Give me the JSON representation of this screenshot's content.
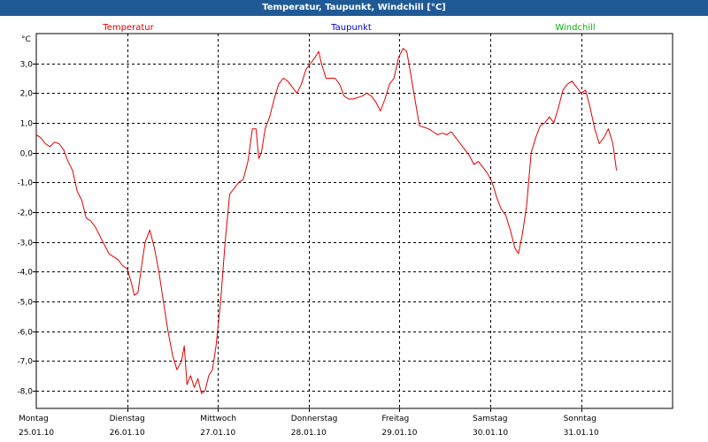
{
  "window": {
    "title": "Temperatur, Taupunkt, Windchill [°C]"
  },
  "legend": [
    {
      "name": "Temperatur",
      "color": "#e00000"
    },
    {
      "name": "Taupunkt",
      "color": "#0000d0"
    },
    {
      "name": "Windchill",
      "color": "#10b010"
    }
  ],
  "chart_data": {
    "type": "line",
    "title": "Temperatur, Taupunkt, Windchill [°C]",
    "ylabel": "°C",
    "xlabel": "",
    "ylim": [
      -8.6,
      4.0
    ],
    "xlim": [
      0,
      7
    ],
    "grid": true,
    "legend_position": "top",
    "y_ticks": [
      "3,0",
      "2,0",
      "1,0",
      "0,0",
      "-1,0",
      "-2,0",
      "-3,0",
      "-4,0",
      "-5,0",
      "-6,0",
      "-7,0",
      "-8,0"
    ],
    "y_tick_values": [
      3,
      2,
      1,
      0,
      -1,
      -2,
      -3,
      -4,
      -5,
      -6,
      -7,
      -8
    ],
    "x_categories": [
      {
        "day": "Montag",
        "date": "25.01.10"
      },
      {
        "day": "Dienstag",
        "date": "26.01.10"
      },
      {
        "day": "Mittwoch",
        "date": "27.01.10"
      },
      {
        "day": "Donnerstag",
        "date": "28.01.10"
      },
      {
        "day": "Freitag",
        "date": "29.01.10"
      },
      {
        "day": "Samstag",
        "date": "30.01.10"
      },
      {
        "day": "Sonntag",
        "date": "31.01.10"
      }
    ],
    "series": [
      {
        "name": "Temperatur",
        "color": "#e00000",
        "points": [
          [
            0.0,
            0.6
          ],
          [
            0.05,
            0.5
          ],
          [
            0.1,
            0.3
          ],
          [
            0.15,
            0.2
          ],
          [
            0.2,
            0.35
          ],
          [
            0.25,
            0.3
          ],
          [
            0.3,
            0.1
          ],
          [
            0.35,
            -0.3
          ],
          [
            0.4,
            -0.6
          ],
          [
            0.45,
            -1.3
          ],
          [
            0.5,
            -1.6
          ],
          [
            0.55,
            -2.2
          ],
          [
            0.6,
            -2.3
          ],
          [
            0.65,
            -2.5
          ],
          [
            0.7,
            -2.8
          ],
          [
            0.75,
            -3.1
          ],
          [
            0.8,
            -3.4
          ],
          [
            0.85,
            -3.5
          ],
          [
            0.9,
            -3.6
          ],
          [
            0.95,
            -3.8
          ],
          [
            1.0,
            -3.9
          ],
          [
            1.05,
            -4.4
          ],
          [
            1.08,
            -4.8
          ],
          [
            1.12,
            -4.7
          ],
          [
            1.17,
            -3.6
          ],
          [
            1.2,
            -3.0
          ],
          [
            1.25,
            -2.6
          ],
          [
            1.3,
            -3.2
          ],
          [
            1.35,
            -4.0
          ],
          [
            1.4,
            -5.0
          ],
          [
            1.45,
            -6.0
          ],
          [
            1.5,
            -6.8
          ],
          [
            1.55,
            -7.3
          ],
          [
            1.6,
            -7.0
          ],
          [
            1.63,
            -6.5
          ],
          [
            1.66,
            -7.8
          ],
          [
            1.7,
            -7.5
          ],
          [
            1.74,
            -7.9
          ],
          [
            1.78,
            -7.6
          ],
          [
            1.82,
            -8.1
          ],
          [
            1.86,
            -8.0
          ],
          [
            1.9,
            -7.5
          ],
          [
            1.94,
            -7.3
          ],
          [
            1.98,
            -6.5
          ],
          [
            2.03,
            -5.0
          ],
          [
            2.08,
            -3.0
          ],
          [
            2.13,
            -1.4
          ],
          [
            2.18,
            -1.2
          ],
          [
            2.23,
            -1.0
          ],
          [
            2.28,
            -0.9
          ],
          [
            2.33,
            -0.3
          ],
          [
            2.38,
            0.8
          ],
          [
            2.42,
            0.8
          ],
          [
            2.45,
            -0.2
          ],
          [
            2.48,
            0.0
          ],
          [
            2.52,
            0.8
          ],
          [
            2.57,
            1.2
          ],
          [
            2.62,
            1.8
          ],
          [
            2.67,
            2.3
          ],
          [
            2.72,
            2.5
          ],
          [
            2.77,
            2.4
          ],
          [
            2.82,
            2.2
          ],
          [
            2.87,
            2.0
          ],
          [
            2.92,
            2.3
          ],
          [
            2.97,
            2.8
          ],
          [
            3.02,
            3.0
          ],
          [
            3.07,
            3.2
          ],
          [
            3.11,
            3.4
          ],
          [
            3.14,
            3.0
          ],
          [
            3.19,
            2.5
          ],
          [
            3.24,
            2.5
          ],
          [
            3.29,
            2.5
          ],
          [
            3.34,
            2.3
          ],
          [
            3.39,
            1.9
          ],
          [
            3.44,
            1.8
          ],
          [
            3.49,
            1.8
          ],
          [
            3.54,
            1.85
          ],
          [
            3.59,
            1.9
          ],
          [
            3.64,
            2.0
          ],
          [
            3.69,
            1.9
          ],
          [
            3.74,
            1.7
          ],
          [
            3.79,
            1.4
          ],
          [
            3.84,
            1.8
          ],
          [
            3.89,
            2.3
          ],
          [
            3.94,
            2.5
          ],
          [
            3.99,
            3.2
          ],
          [
            4.04,
            3.5
          ],
          [
            4.08,
            3.4
          ],
          [
            4.12,
            2.7
          ],
          [
            4.17,
            1.8
          ],
          [
            4.22,
            0.9
          ],
          [
            4.27,
            0.85
          ],
          [
            4.32,
            0.8
          ],
          [
            4.37,
            0.7
          ],
          [
            4.42,
            0.6
          ],
          [
            4.47,
            0.65
          ],
          [
            4.52,
            0.6
          ],
          [
            4.57,
            0.7
          ],
          [
            4.62,
            0.5
          ],
          [
            4.67,
            0.3
          ],
          [
            4.72,
            0.1
          ],
          [
            4.77,
            -0.1
          ],
          [
            4.82,
            -0.4
          ],
          [
            4.87,
            -0.3
          ],
          [
            4.92,
            -0.5
          ],
          [
            4.97,
            -0.7
          ],
          [
            5.02,
            -1.0
          ],
          [
            5.07,
            -1.5
          ],
          [
            5.12,
            -1.9
          ],
          [
            5.17,
            -2.1
          ],
          [
            5.22,
            -2.6
          ],
          [
            5.27,
            -3.2
          ],
          [
            5.31,
            -3.4
          ],
          [
            5.35,
            -2.8
          ],
          [
            5.4,
            -1.8
          ],
          [
            5.45,
            0.0
          ],
          [
            5.5,
            0.5
          ],
          [
            5.55,
            0.9
          ],
          [
            5.6,
            1.0
          ],
          [
            5.65,
            1.2
          ],
          [
            5.7,
            1.0
          ],
          [
            5.75,
            1.5
          ],
          [
            5.8,
            2.1
          ],
          [
            5.85,
            2.3
          ],
          [
            5.9,
            2.4
          ],
          [
            5.95,
            2.2
          ],
          [
            6.0,
            2.0
          ],
          [
            6.05,
            2.1
          ],
          [
            6.1,
            1.5
          ],
          [
            6.15,
            0.8
          ],
          [
            6.2,
            0.3
          ],
          [
            6.25,
            0.5
          ],
          [
            6.3,
            0.8
          ],
          [
            6.35,
            0.3
          ],
          [
            6.39,
            -0.6
          ]
        ]
      }
    ]
  }
}
